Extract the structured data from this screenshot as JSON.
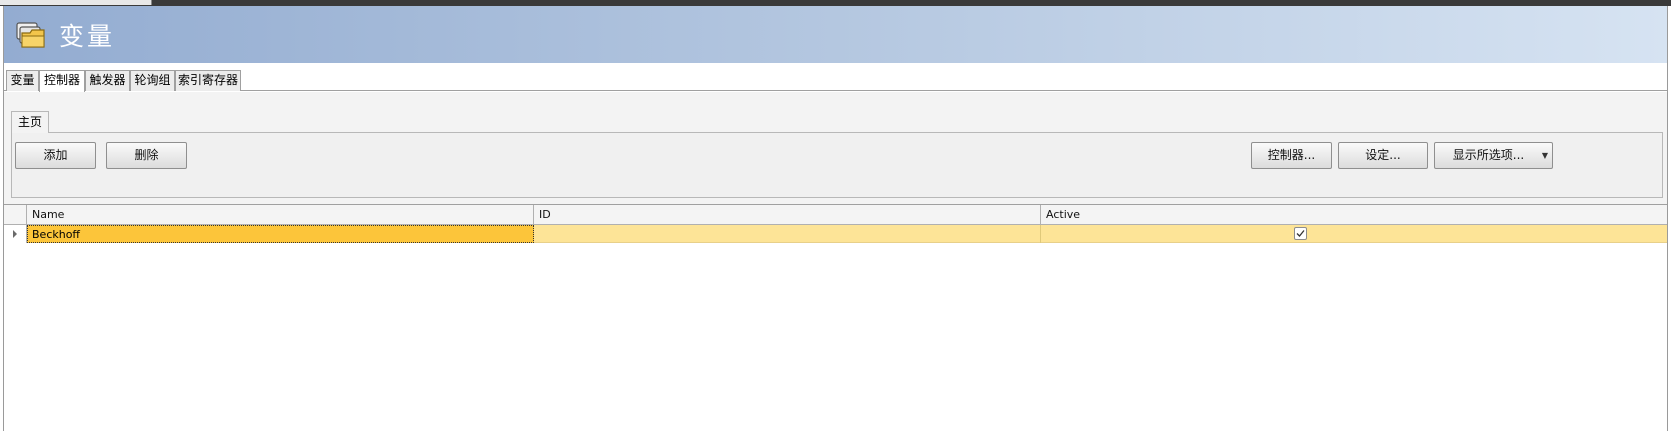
{
  "header": {
    "title": "变量",
    "icon": "folder-stack-icon"
  },
  "main_tabs": [
    {
      "label": "变量"
    },
    {
      "label": "控制器"
    },
    {
      "label": "触发器"
    },
    {
      "label": "轮询组"
    },
    {
      "label": "索引寄存器"
    }
  ],
  "ribbon": {
    "tab_label": "主页",
    "add_label": "添加",
    "delete_label": "删除",
    "controller_label": "控制器...",
    "settings_label": "设定...",
    "show_selected_label": "显示所选项..."
  },
  "grid": {
    "columns": [
      "Name",
      "ID",
      "Active"
    ],
    "rows": [
      {
        "name": "Beckhoff",
        "id": "",
        "active": true
      }
    ]
  },
  "colors": {
    "header_gradient_start": "#93acd1",
    "header_gradient_end": "#d6e3f2",
    "row_highlight": "#fde497",
    "selected_cell": "#fcc53a"
  }
}
